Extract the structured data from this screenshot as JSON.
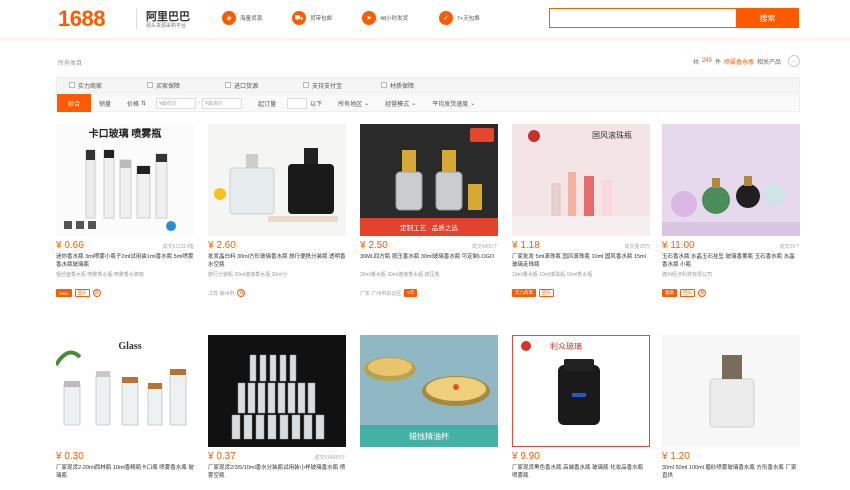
{
  "header": {
    "logo_text": "1688",
    "brand_cn": "阿里巴巴",
    "brand_sub": "源头货源采购平台",
    "features": [
      {
        "icon": "grid-icon",
        "label": "海量货源"
      },
      {
        "icon": "truck-icon",
        "label": "货带包邮"
      },
      {
        "icon": "rocket-icon",
        "label": "48小时发货"
      },
      {
        "icon": "check-icon",
        "label": "7+天包换"
      }
    ],
    "search_placeholder": "",
    "search_button": "搜索"
  },
  "breadcrumb": "所有类目",
  "result": {
    "prefix": "共",
    "count": "245",
    "unit": "件",
    "keyword": "喷雾香水瓶",
    "suffix": "相关产品"
  },
  "filters": {
    "checkboxes": [
      "实力商家",
      "买家保障",
      "进口货源",
      "支持支付宝",
      "材质保障"
    ],
    "sort_active": "综合",
    "sort_items": [
      "销量",
      "价格"
    ],
    "price_min_placeholder": "¥最低价",
    "price_max_placeholder": "¥最高价",
    "moq_label": "起订量",
    "moq_unit": "以下",
    "dropdowns": [
      "所有地区",
      "经营模式",
      "平均发货速度"
    ]
  },
  "accent_color": "#ff5a00",
  "products": [
    {
      "price": "¥ 0.66",
      "sold": "成交512114笔",
      "title": "迷你香水瓶 3ml喷雾小瓶子2ml试用装1ml香水瓶 5ml喷雾香水瓶玻璃瓶",
      "sub": "钢丝面香水瓶  喷雾香水瓶  喷雾香水玻璃",
      "img_text": "卡口玻璃 喷雾瓶",
      "tags": [
        "beck",
        "回头",
        "源"
      ],
      "loc": ""
    },
    {
      "price": "¥ 2.60",
      "sold": "",
      "title": "批发晶白料 30ml方形玻璃香水瓶 旅行便携分装瓶 透明香水空瓶",
      "sub": "旅行分装瓶  30ml玻璃香水瓶  30ml分",
      "img_text": "",
      "tags": [
        "源"
      ],
      "loc": "江苏 徐州市"
    },
    {
      "price": "¥ 2.50",
      "sold": "成交4000个",
      "title": "30ML四方瓶 按压香水瓶 30ml玻璃香水瓶 可定制LOGO",
      "sub": "30ml香水瓶  30ml玻璃香水瓶  按压香",
      "img_text": "定制工艺 · 品质之选",
      "tags": [
        "5年"
      ],
      "loc": "广东 广州市白云区"
    },
    {
      "price": "¥ 1.18",
      "sold": "成交量20万",
      "title": "厂家批发 5ml滚珠瓶 国风滚珠瓶 10ml 国风香水瓶 15ml玻璃走珠瓶",
      "sub": "10ml香水瓶  10ml滚珠瓶  15ml香水瓶",
      "img_text": "国风滚珠瓶",
      "tags": [
        "实力商家",
        "回头"
      ],
      "loc": ""
    },
    {
      "price": "¥ 11.00",
      "sold": "成交29个",
      "title": "玉石香水瓶 水晶玉石挂坠 玻璃香薰瓶 玉石香水瓶 水晶香水瓶 小瓶",
      "sub": "德州经济科技有限公司",
      "img_text": "",
      "tags": [
        "超级",
        "回头",
        "源"
      ],
      "loc": ""
    },
    {
      "price": "¥ 0.30",
      "sold": "",
      "title": "厂家现货2-20ml西林瓶 10ml香精瓶卡口瓶 喷雾香水瓶 玻璃瓶",
      "sub": "",
      "img_text": "Glass",
      "tags": [],
      "loc": ""
    },
    {
      "price": "¥ 0.37",
      "sold": "成交514683个",
      "title": "厂家现货2/3/5/10ml香水分装瓶试用装小样玻璃香水瓶 喷雾空瓶",
      "sub": "",
      "img_text": "",
      "tags": [],
      "loc": ""
    },
    {
      "price": "",
      "sold": "",
      "title": "",
      "sub": "",
      "img_text": "蜡烛精油杯",
      "tags": [],
      "loc": ""
    },
    {
      "price": "¥ 9.90",
      "sold": "",
      "title": "厂家现货黑色香水瓶 高端香水瓶 玻璃瓶 化妆品香水瓶 喷雾瓶",
      "sub": "",
      "img_text": "利众玻璃",
      "tags": [],
      "loc": ""
    },
    {
      "price": "¥ 1.20",
      "sold": "",
      "title": "30ml 50ml 100ml 磨砂喷雾玻璃香水瓶 方形香水瓶 厂家直供",
      "sub": "",
      "img_text": "",
      "tags": [],
      "loc": ""
    }
  ]
}
